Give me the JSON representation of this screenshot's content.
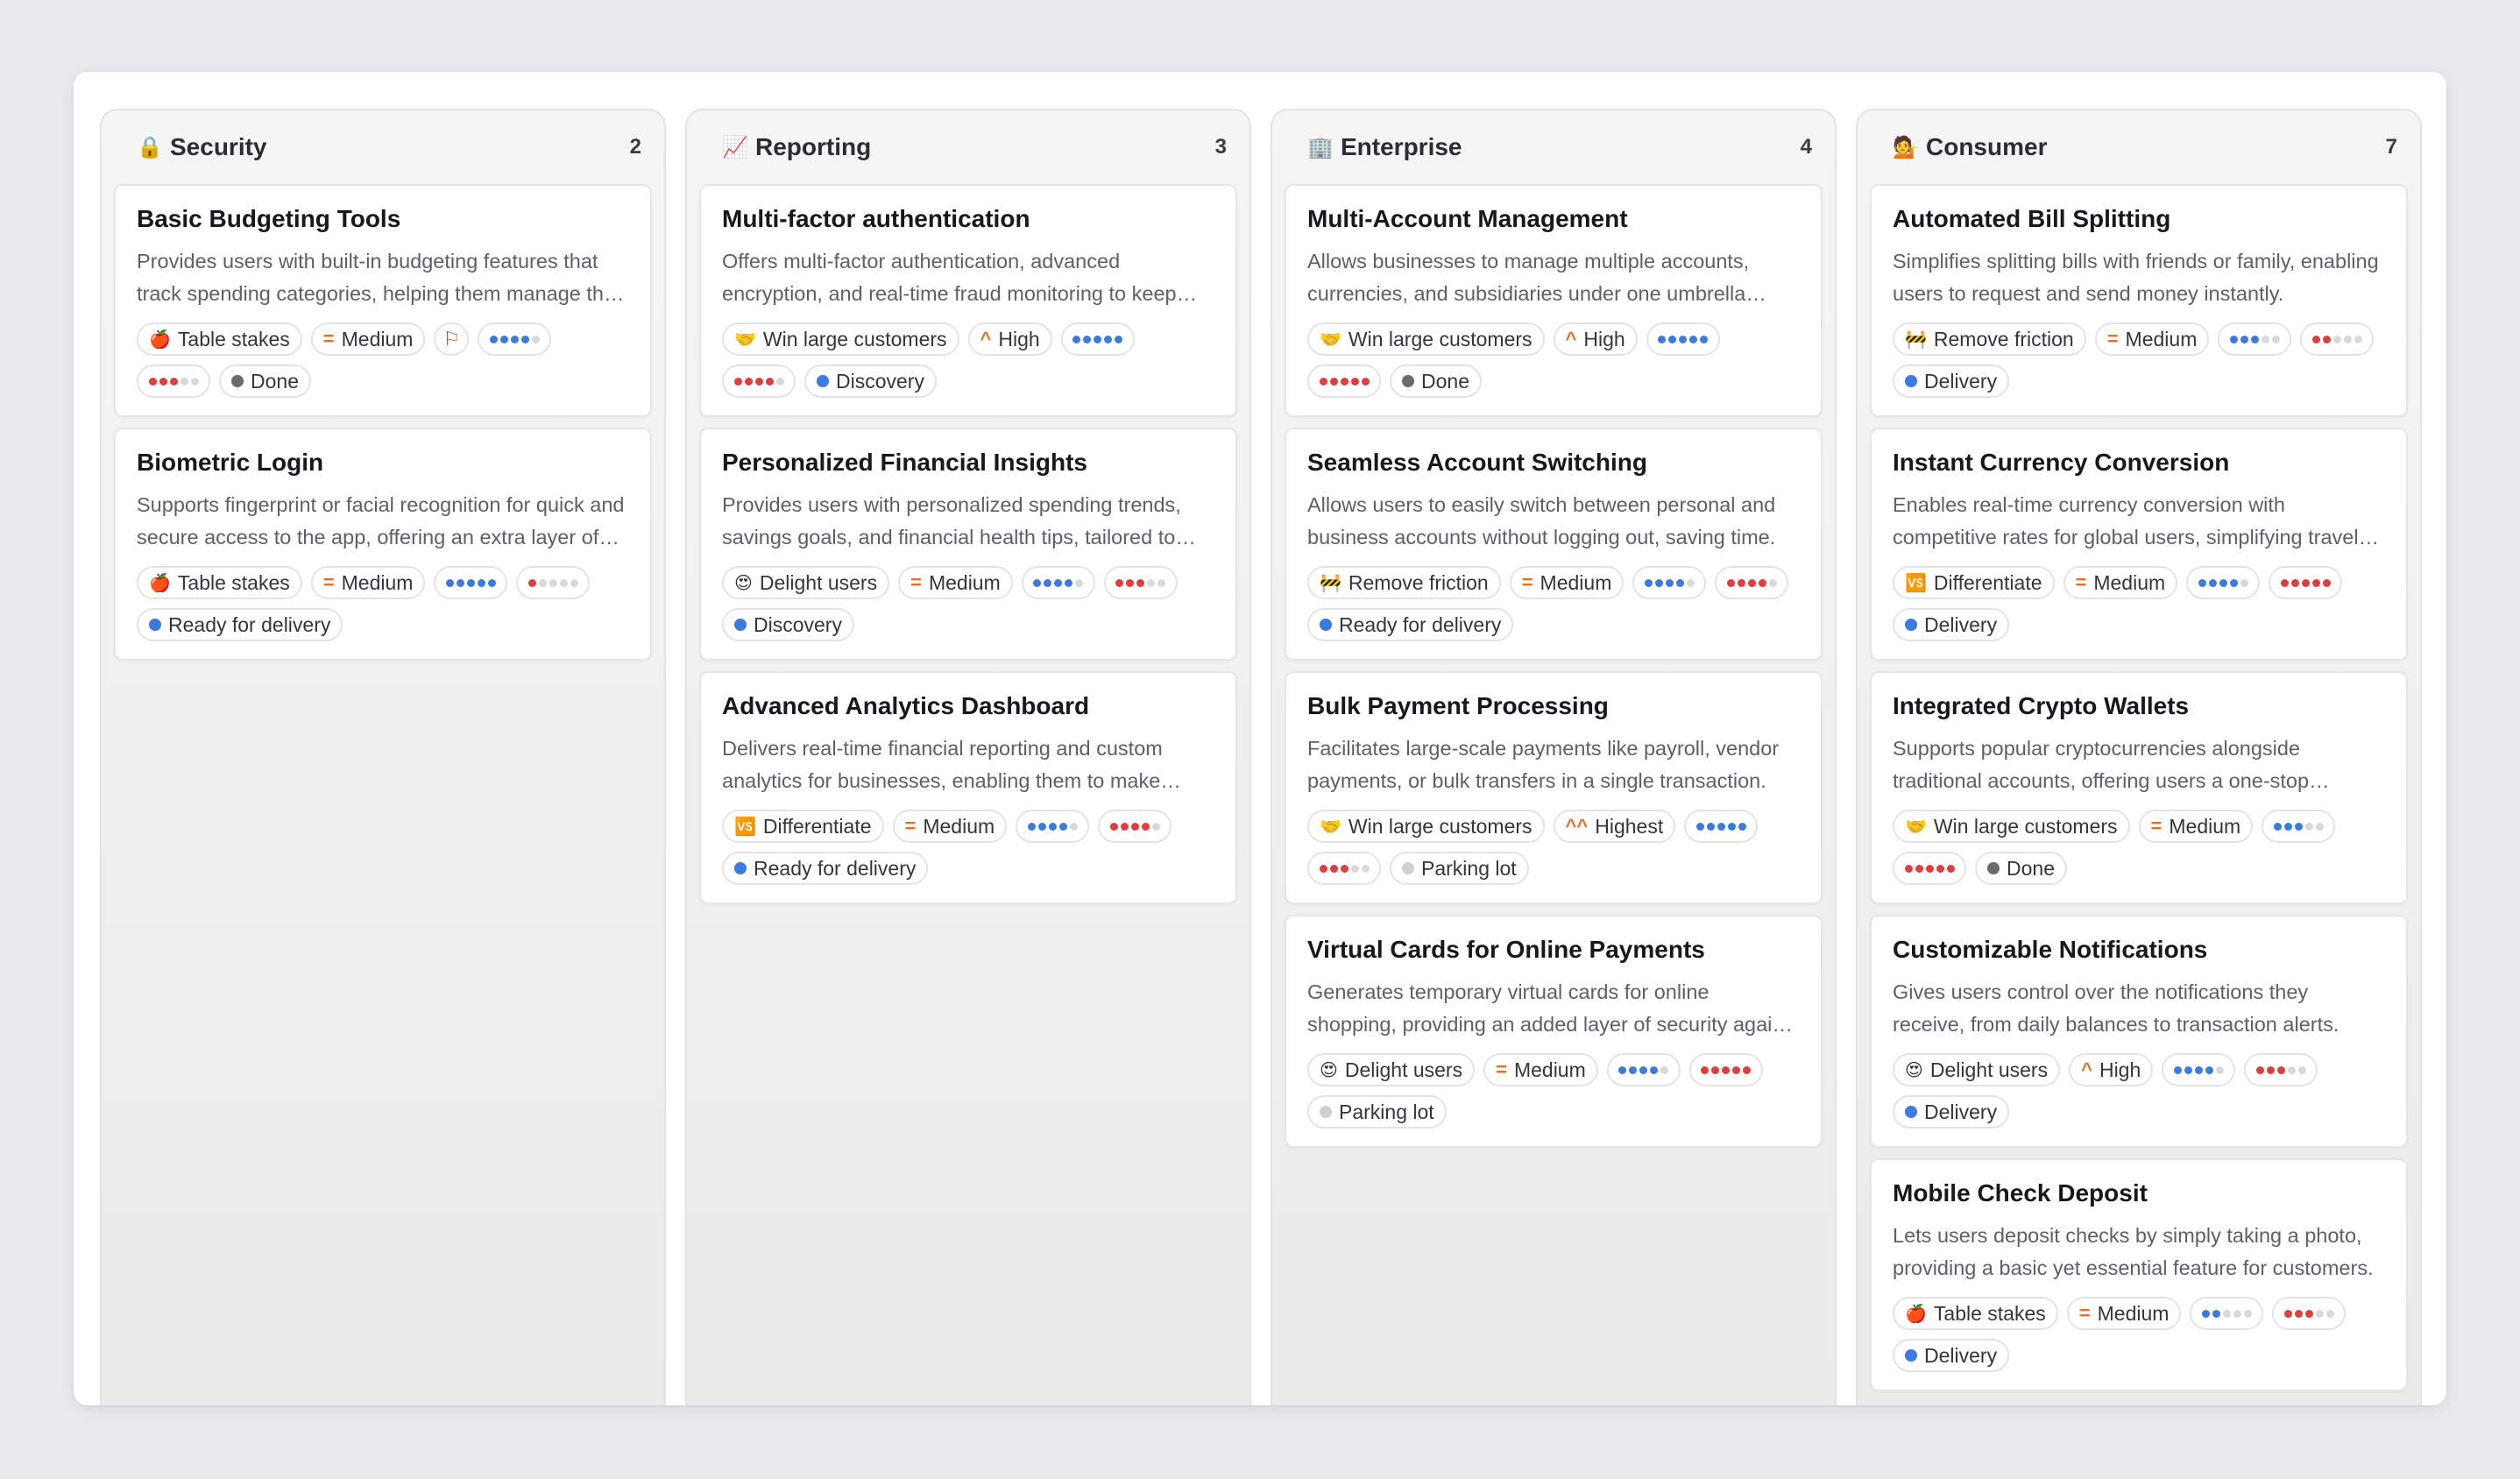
{
  "colors": {
    "blue_dot": "#3b7ae0",
    "red_dot": "#e23c3c",
    "empty_dot": "#d9d9d9",
    "status_done": "#6b6b6b",
    "status_blue": "#3b7ae0",
    "status_parking": "#cfcfcf",
    "priority_orange": "#e5702a",
    "flag_red": "#e04444"
  },
  "columns": [
    {
      "emoji": "🔒",
      "title": "Security",
      "count": "2",
      "cards": [
        {
          "title": "Basic Budgeting Tools",
          "desc": "Provides users with built-in budgeting features that track spending categories, helping them manage their finances.",
          "chips": [
            {
              "kind": "tag",
              "icon": "🍎",
              "label": "Table stakes"
            },
            {
              "kind": "priority",
              "icon": "=",
              "label": "Medium"
            },
            {
              "kind": "flag",
              "icon": "⚐"
            },
            {
              "kind": "dots",
              "color": "blue",
              "filled": 4
            },
            {
              "kind": "dots",
              "color": "red",
              "filled": 3
            },
            {
              "kind": "status",
              "status": "done",
              "label": "Done"
            }
          ]
        },
        {
          "title": "Biometric Login",
          "desc": "Supports fingerprint or facial recognition for quick and secure access to the app, offering an extra layer of protection.",
          "chips": [
            {
              "kind": "tag",
              "icon": "🍎",
              "label": "Table stakes"
            },
            {
              "kind": "priority",
              "icon": "=",
              "label": "Medium"
            },
            {
              "kind": "dots",
              "color": "blue",
              "filled": 5
            },
            {
              "kind": "dots",
              "color": "red",
              "filled": 1
            },
            {
              "kind": "status",
              "status": "blue",
              "label": "Ready for delivery"
            }
          ]
        }
      ]
    },
    {
      "emoji": "📈",
      "title": "Reporting",
      "count": "3",
      "cards": [
        {
          "title": "Multi-factor authentication",
          "desc": "Offers multi-factor authentication, advanced encryption, and real-time fraud monitoring to keep accounts safe.",
          "chips": [
            {
              "kind": "tag",
              "icon": "🤝",
              "label": "Win large customers"
            },
            {
              "kind": "priority",
              "icon": "^",
              "label": "High"
            },
            {
              "kind": "dots",
              "color": "blue",
              "filled": 5
            },
            {
              "kind": "dots",
              "color": "red",
              "filled": 4
            },
            {
              "kind": "status",
              "status": "blue",
              "label": "Discovery"
            }
          ]
        },
        {
          "title": "Personalized Financial Insights",
          "desc": "Provides users with personalized spending trends, savings goals, and financial health tips, tailored to them.",
          "chips": [
            {
              "kind": "tag",
              "icon": "😍",
              "label": "Delight users"
            },
            {
              "kind": "priority",
              "icon": "=",
              "label": "Medium"
            },
            {
              "kind": "dots",
              "color": "blue",
              "filled": 4
            },
            {
              "kind": "dots",
              "color": "red",
              "filled": 3
            },
            {
              "kind": "status",
              "status": "blue",
              "label": "Discovery"
            }
          ]
        },
        {
          "title": "Advanced Analytics Dashboard",
          "desc": "Delivers real-time financial reporting and custom analytics for businesses, enabling them to make decisions.",
          "chips": [
            {
              "kind": "tag",
              "icon": "🆚",
              "label": "Differentiate"
            },
            {
              "kind": "priority",
              "icon": "=",
              "label": "Medium"
            },
            {
              "kind": "dots",
              "color": "blue",
              "filled": 4
            },
            {
              "kind": "dots",
              "color": "red",
              "filled": 4
            },
            {
              "kind": "status",
              "status": "blue",
              "label": "Ready for delivery"
            }
          ]
        }
      ]
    },
    {
      "emoji": "🏢",
      "title": "Enterprise",
      "count": "4",
      "cards": [
        {
          "title": "Multi-Account Management",
          "desc": "Allows businesses to manage multiple accounts, currencies, and subsidiaries under one umbrella account.",
          "chips": [
            {
              "kind": "tag",
              "icon": "🤝",
              "label": "Win large customers"
            },
            {
              "kind": "priority",
              "icon": "^",
              "label": "High"
            },
            {
              "kind": "dots",
              "color": "blue",
              "filled": 5
            },
            {
              "kind": "dots",
              "color": "red",
              "filled": 5
            },
            {
              "kind": "status",
              "status": "done",
              "label": "Done"
            }
          ]
        },
        {
          "title": "Seamless Account Switching",
          "desc": "Allows users to easily switch between personal and business accounts without logging out, saving time.",
          "chips": [
            {
              "kind": "tag",
              "icon": "🚧",
              "label": "Remove friction"
            },
            {
              "kind": "priority",
              "icon": "=",
              "label": "Medium"
            },
            {
              "kind": "dots",
              "color": "blue",
              "filled": 4
            },
            {
              "kind": "dots",
              "color": "red",
              "filled": 4
            },
            {
              "kind": "status",
              "status": "blue",
              "label": "Ready for delivery"
            }
          ]
        },
        {
          "title": "Bulk Payment Processing",
          "desc": "Facilitates large-scale payments like payroll, vendor payments, or bulk transfers in a single transaction.",
          "chips": [
            {
              "kind": "tag",
              "icon": "🤝",
              "label": "Win large customers"
            },
            {
              "kind": "priority",
              "icon": "^^",
              "label": "Highest"
            },
            {
              "kind": "dots",
              "color": "blue",
              "filled": 5
            },
            {
              "kind": "dots",
              "color": "red",
              "filled": 3
            },
            {
              "kind": "status",
              "status": "parking",
              "label": "Parking lot"
            }
          ]
        },
        {
          "title": "Virtual Cards for Online Payments",
          "desc": "Generates temporary virtual cards for online shopping, providing an added layer of security against fraud.",
          "chips": [
            {
              "kind": "tag",
              "icon": "😍",
              "label": "Delight users"
            },
            {
              "kind": "priority",
              "icon": "=",
              "label": "Medium"
            },
            {
              "kind": "dots",
              "color": "blue",
              "filled": 4
            },
            {
              "kind": "dots",
              "color": "red",
              "filled": 5
            },
            {
              "kind": "status",
              "status": "parking",
              "label": "Parking lot"
            }
          ]
        }
      ]
    },
    {
      "emoji": "💁",
      "title": "Consumer",
      "count": "7",
      "cards": [
        {
          "title": "Automated Bill Splitting",
          "desc": "Simplifies splitting bills with friends or family, enabling users to request and send money instantly.",
          "chips": [
            {
              "kind": "tag",
              "icon": "🚧",
              "label": "Remove friction"
            },
            {
              "kind": "priority",
              "icon": "=",
              "label": "Medium"
            },
            {
              "kind": "dots",
              "color": "blue",
              "filled": 3
            },
            {
              "kind": "dots",
              "color": "red",
              "filled": 2
            },
            {
              "kind": "status",
              "status": "blue",
              "label": "Delivery"
            }
          ]
        },
        {
          "title": "Instant Currency Conversion",
          "desc": "Enables real-time currency conversion with competitive rates for global users, simplifying travel spend.",
          "chips": [
            {
              "kind": "tag",
              "icon": "🆚",
              "label": "Differentiate"
            },
            {
              "kind": "priority",
              "icon": "=",
              "label": "Medium"
            },
            {
              "kind": "dots",
              "color": "blue",
              "filled": 4
            },
            {
              "kind": "dots",
              "color": "red",
              "filled": 5
            },
            {
              "kind": "status",
              "status": "blue",
              "label": "Delivery"
            }
          ]
        },
        {
          "title": "Integrated Crypto Wallets",
          "desc": "Supports popular cryptocurrencies alongside traditional accounts, offering users a one-stop solution.",
          "chips": [
            {
              "kind": "tag",
              "icon": "🤝",
              "label": "Win large customers"
            },
            {
              "kind": "priority",
              "icon": "=",
              "label": "Medium"
            },
            {
              "kind": "dots",
              "color": "blue",
              "filled": 3
            },
            {
              "kind": "dots",
              "color": "red",
              "filled": 5
            },
            {
              "kind": "status",
              "status": "done",
              "label": "Done"
            }
          ]
        },
        {
          "title": "Customizable Notifications",
          "desc": "Gives users control over the notifications they receive, from daily balances to transaction alerts.",
          "chips": [
            {
              "kind": "tag",
              "icon": "😍",
              "label": "Delight users"
            },
            {
              "kind": "priority",
              "icon": "^",
              "label": "High"
            },
            {
              "kind": "dots",
              "color": "blue",
              "filled": 4
            },
            {
              "kind": "dots",
              "color": "red",
              "filled": 3
            },
            {
              "kind": "status",
              "status": "blue",
              "label": "Delivery"
            }
          ]
        },
        {
          "title": "Mobile Check Deposit",
          "desc": "Lets users deposit checks by simply taking a photo, providing a basic yet essential feature for customers.",
          "chips": [
            {
              "kind": "tag",
              "icon": "🍎",
              "label": "Table stakes"
            },
            {
              "kind": "priority",
              "icon": "=",
              "label": "Medium"
            },
            {
              "kind": "dots",
              "color": "blue",
              "filled": 2
            },
            {
              "kind": "dots",
              "color": "red",
              "filled": 3
            },
            {
              "kind": "status",
              "status": "blue",
              "label": "Delivery"
            }
          ]
        }
      ]
    }
  ]
}
